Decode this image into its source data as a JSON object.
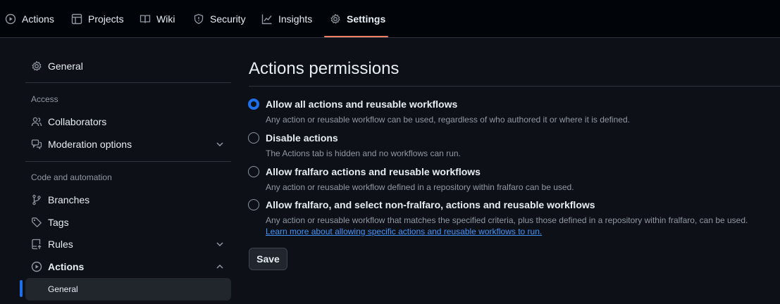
{
  "nav": {
    "tabs": [
      {
        "label": "Actions",
        "icon": "play-icon"
      },
      {
        "label": "Projects",
        "icon": "table-icon"
      },
      {
        "label": "Wiki",
        "icon": "book-icon"
      },
      {
        "label": "Security",
        "icon": "shield-icon"
      },
      {
        "label": "Insights",
        "icon": "graph-icon"
      },
      {
        "label": "Settings",
        "icon": "gear-icon",
        "active": true
      }
    ],
    "active_color": "#f78166"
  },
  "sidebar": {
    "general": "General",
    "access_heading": "Access",
    "collaborators": "Collaborators",
    "moderation": "Moderation options",
    "code_heading": "Code and automation",
    "branches": "Branches",
    "tags": "Tags",
    "rules": "Rules",
    "actions": "Actions",
    "actions_general": "General"
  },
  "main": {
    "title": "Actions permissions",
    "options": [
      {
        "label": "Allow all actions and reusable workflows",
        "desc": "Any action or reusable workflow can be used, regardless of who authored it or where it is defined.",
        "checked": true
      },
      {
        "label": "Disable actions",
        "desc": "The Actions tab is hidden and no workflows can run.",
        "checked": false
      },
      {
        "label": "Allow fralfaro actions and reusable workflows",
        "desc": "Any action or reusable workflow defined in a repository within fralfaro can be used.",
        "checked": false
      },
      {
        "label": "Allow fralfaro, and select non-fralfaro, actions and reusable workflows",
        "desc": "Any action or reusable workflow that matches the specified criteria, plus those defined in a repository within fralfaro, can be used.",
        "link": "Learn more about allowing specific actions and reusable workflows to run.",
        "checked": false
      }
    ],
    "save_label": "Save",
    "accent": "#1f6feb"
  }
}
